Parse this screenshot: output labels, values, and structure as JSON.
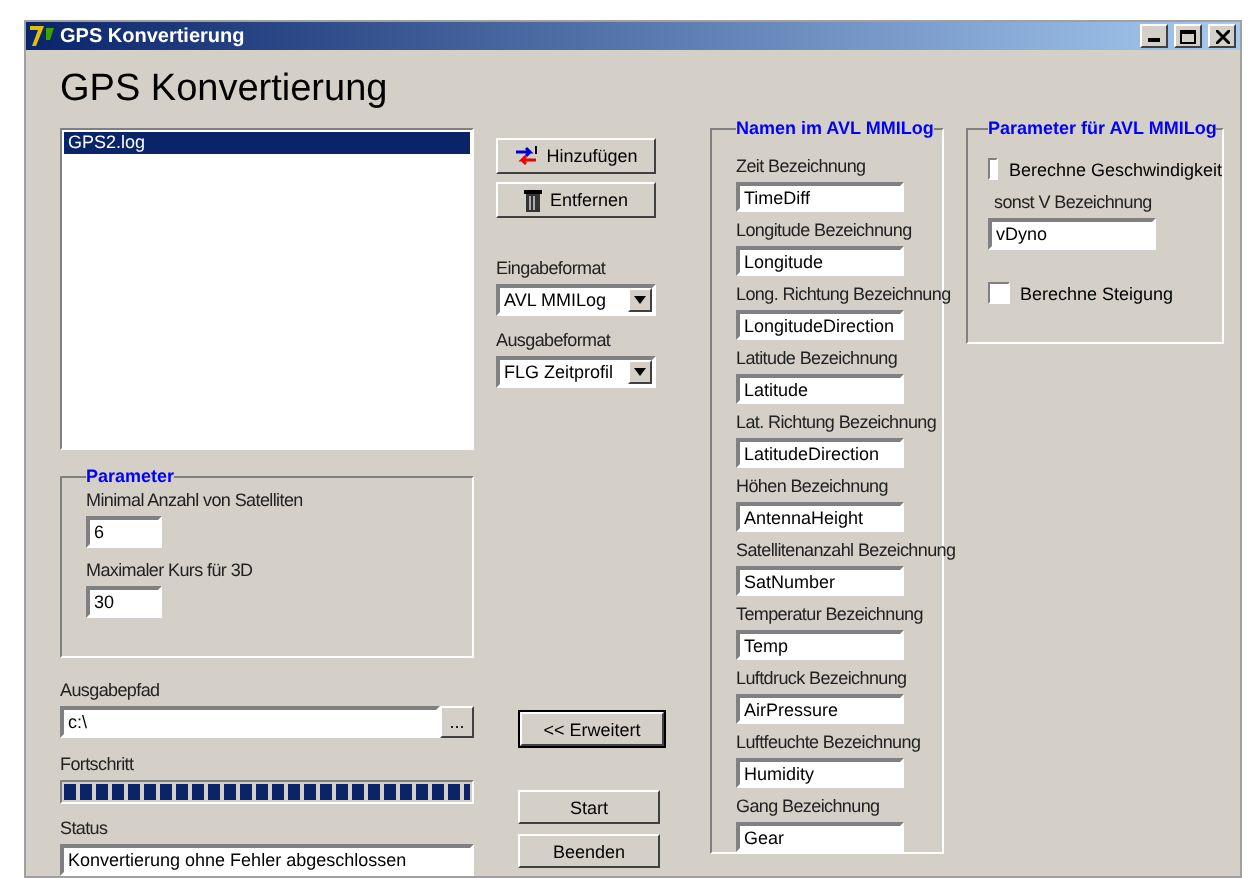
{
  "window": {
    "title": "GPS Konvertierung"
  },
  "heading": "GPS Konvertierung",
  "files": [
    {
      "name": "GPS2.log",
      "selected": true
    }
  ],
  "file_buttons": [
    {
      "kind": "add",
      "label": "Hinzufügen"
    },
    {
      "kind": "remove",
      "label": "Entfernen"
    }
  ],
  "formats": [
    {
      "label": "Eingabeformat",
      "value": "AVL MMILog"
    },
    {
      "label": "Ausgabeformat",
      "value": "FLG Zeitprofil"
    }
  ],
  "parameter": {
    "title": "Parameter",
    "fields": [
      {
        "label": "Minimal Anzahl von Satelliten",
        "value": "6"
      },
      {
        "label": "Maximaler Kurs für 3D",
        "value": "30"
      }
    ]
  },
  "output_path": {
    "label": "Ausgabepfad",
    "value": "c:\\",
    "browse": "..."
  },
  "progress": {
    "label": "Fortschritt",
    "level": 1
  },
  "status": {
    "label": "Status",
    "value": "Konvertierung ohne Fehler abgeschlossen"
  },
  "advanced_button": "<< Erweitert",
  "action_buttons": [
    "Start",
    "Beenden"
  ],
  "names": {
    "title": "Namen im AVL MMILog",
    "fields": [
      {
        "label": "Zeit Bezeichnung",
        "value": "TimeDiff"
      },
      {
        "label": "Longitude Bezeichnung",
        "value": "Longitude"
      },
      {
        "label": "Long. Richtung Bezeichnung",
        "value": "LongitudeDirection"
      },
      {
        "label": "Latitude Bezeichnung",
        "value": "Latitude"
      },
      {
        "label": "Lat. Richtung Bezeichnung",
        "value": "LatitudeDirection"
      },
      {
        "label": "Höhen Bezeichnung",
        "value": "AntennaHeight"
      },
      {
        "label": "Satellitenanzahl Bezeichnung",
        "value": "SatNumber"
      },
      {
        "label": "Temperatur Bezeichnung",
        "value": "Temp"
      },
      {
        "label": "Luftdruck Bezeichnung",
        "value": "AirPressure"
      },
      {
        "label": "Luftfeuchte Bezeichnung",
        "value": "Humidity"
      },
      {
        "label": "Gang Bezeichnung",
        "value": "Gear"
      }
    ]
  },
  "avl_params": {
    "title": "Parameter für AVL MMILog",
    "speed": {
      "label": "Berechne Geschwindigkeit",
      "checked": false
    },
    "v_label": "sonst V Bezeichnung",
    "v_value": "vDyno",
    "slope": {
      "label": "Berechne Steigung",
      "checked": false
    }
  }
}
